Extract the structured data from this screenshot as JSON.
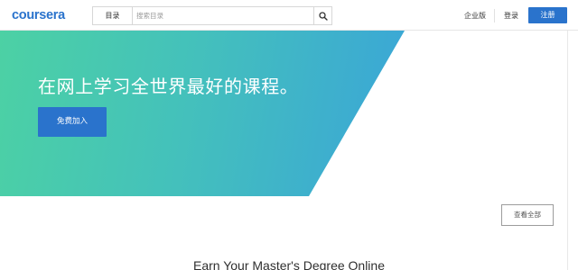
{
  "header": {
    "logo": "coursera",
    "catalog_label": "目录",
    "search_placeholder": "搜索目录",
    "search_icon": "search-icon",
    "enterprise_label": "企业版",
    "login_label": "登录",
    "signup_label": "注册"
  },
  "hero": {
    "title": "在网上学习全世界最好的课程。",
    "join_label": "免费加入"
  },
  "main": {
    "view_all_label": "查看全部",
    "section_heading": "Earn Your Master's Degree Online"
  },
  "colors": {
    "brand_blue": "#2a73cc",
    "hero_gradient_start": "#4cd1a4",
    "hero_gradient_end": "#3aa5d8"
  }
}
